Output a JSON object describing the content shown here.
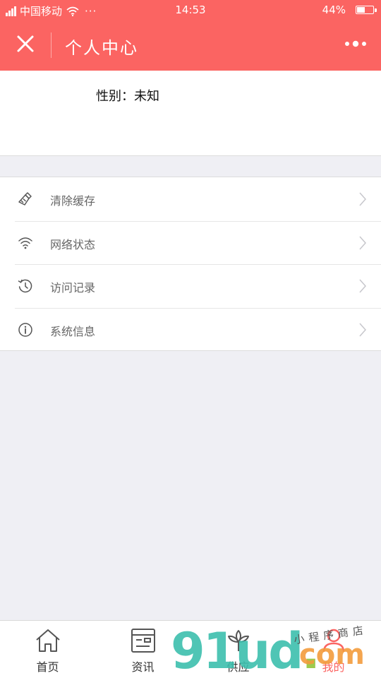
{
  "status_bar": {
    "carrier": "中国移动",
    "more": "···",
    "time": "14:53",
    "battery_text": "44%",
    "battery_level": 0.44
  },
  "nav": {
    "close_icon": "close-icon",
    "title": "个人中心",
    "more_icon": "more-dots-icon"
  },
  "profile": {
    "gender": "性别：未知"
  },
  "menu": {
    "items": [
      {
        "icon": "broom-icon",
        "label": "清除缓存"
      },
      {
        "icon": "wifi-icon",
        "label": "网络状态"
      },
      {
        "icon": "history-icon",
        "label": "访问记录"
      },
      {
        "icon": "info-icon",
        "label": "系统信息"
      }
    ]
  },
  "tabbar": {
    "items": [
      {
        "icon": "home-icon",
        "label": "首页"
      },
      {
        "icon": "news-icon",
        "label": "资讯"
      },
      {
        "icon": "supply-icon",
        "label": "供应"
      },
      {
        "icon": "user-icon",
        "label": "我的"
      }
    ],
    "active_index": 3
  },
  "colors": {
    "brand": "#fb6462",
    "background": "#efeff4"
  },
  "watermark": {
    "brand": "91ud",
    "dot": ".",
    "com": "com",
    "signature": "小程序商店"
  }
}
